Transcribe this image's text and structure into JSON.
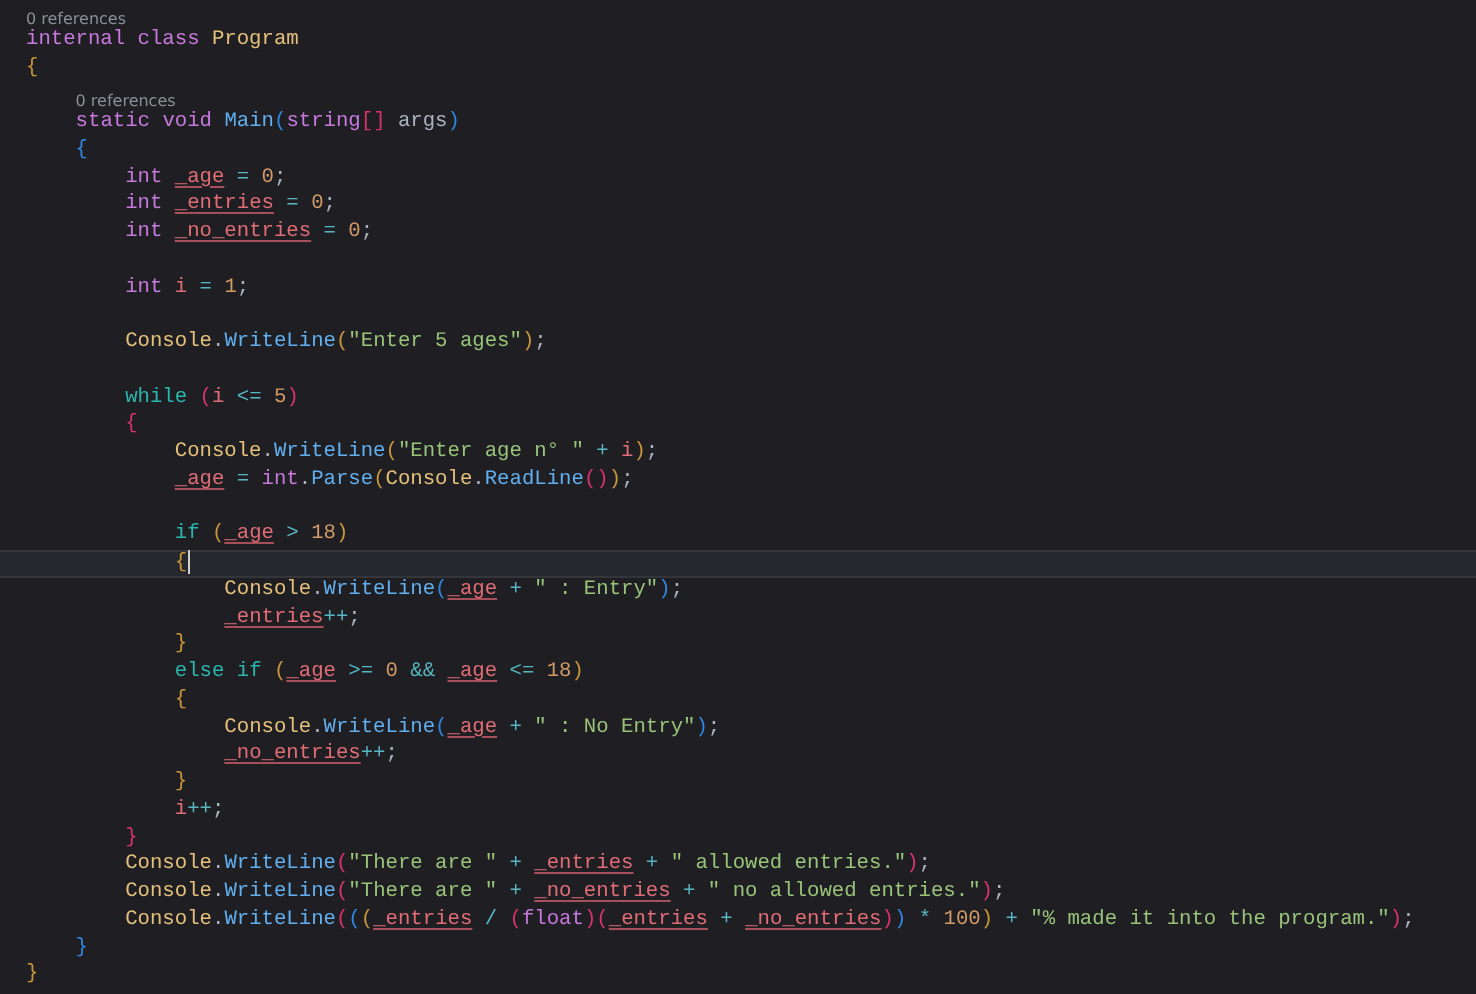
{
  "editor": {
    "lines": [
      {
        "codelens": "0 references",
        "current": false,
        "tokens": [
          {
            "kind": "keyword",
            "text": "internal "
          },
          {
            "kind": "keyword",
            "text": "class "
          },
          {
            "kind": "type",
            "text": "Program"
          }
        ]
      },
      {
        "current": false,
        "tokens": [
          {
            "kind": "bracket1",
            "text": "{"
          }
        ]
      },
      {
        "codelens": "0 references",
        "current": false,
        "tokens": [
          {
            "kind": "keyword",
            "text": "    static "
          },
          {
            "kind": "keyword",
            "text": "void "
          },
          {
            "kind": "method",
            "text": "Main"
          },
          {
            "kind": "bracket3",
            "text": "("
          },
          {
            "kind": "keyword",
            "text": "string"
          },
          {
            "kind": "bracket2",
            "text": "[] "
          },
          {
            "kind": "param",
            "text": "args"
          },
          {
            "kind": "bracket3",
            "text": ")"
          }
        ]
      },
      {
        "current": false,
        "tokens": [
          {
            "kind": "bracket3",
            "text": "    {"
          }
        ]
      },
      {
        "current": false,
        "tokens": [
          {
            "kind": "keyword",
            "text": "        int "
          },
          {
            "kind": "field",
            "text": "_age"
          },
          {
            "kind": "operator",
            "text": " = "
          },
          {
            "kind": "number",
            "text": "0"
          },
          {
            "kind": "plain",
            "text": ";"
          }
        ]
      },
      {
        "current": false,
        "tokens": [
          {
            "kind": "keyword",
            "text": "        int "
          },
          {
            "kind": "field",
            "text": "_entries"
          },
          {
            "kind": "operator",
            "text": " = "
          },
          {
            "kind": "number",
            "text": "0"
          },
          {
            "kind": "plain",
            "text": ";"
          }
        ]
      },
      {
        "current": false,
        "tokens": [
          {
            "kind": "keyword",
            "text": "        int "
          },
          {
            "kind": "field",
            "text": "_no_entries"
          },
          {
            "kind": "operator",
            "text": " = "
          },
          {
            "kind": "number",
            "text": "0"
          },
          {
            "kind": "plain",
            "text": ";"
          }
        ]
      },
      {
        "current": false
      },
      {
        "current": false,
        "tokens": [
          {
            "kind": "keyword",
            "text": "        int "
          },
          {
            "kind": "local",
            "text": "i"
          },
          {
            "kind": "operator",
            "text": " = "
          },
          {
            "kind": "number",
            "text": "1"
          },
          {
            "kind": "plain",
            "text": ";"
          }
        ]
      },
      {
        "current": false
      },
      {
        "current": false,
        "tokens": [
          {
            "kind": "type",
            "text": "        Console"
          },
          {
            "kind": "plain",
            "text": "."
          },
          {
            "kind": "method",
            "text": "WriteLine"
          },
          {
            "kind": "bracket1",
            "text": "("
          },
          {
            "kind": "string",
            "text": "\"Enter 5 ages\""
          },
          {
            "kind": "bracket1",
            "text": ")"
          },
          {
            "kind": "plain",
            "text": ";"
          }
        ]
      },
      {
        "current": false
      },
      {
        "current": false,
        "tokens": [
          {
            "kind": "control",
            "text": "        while "
          },
          {
            "kind": "bracket2",
            "text": "("
          },
          {
            "kind": "local",
            "text": "i"
          },
          {
            "kind": "operator",
            "text": " <= "
          },
          {
            "kind": "number",
            "text": "5"
          },
          {
            "kind": "bracket2",
            "text": ")"
          }
        ]
      },
      {
        "current": false,
        "tokens": [
          {
            "kind": "bracket2",
            "text": "        {"
          }
        ]
      },
      {
        "current": false,
        "tokens": [
          {
            "kind": "type",
            "text": "            Console"
          },
          {
            "kind": "plain",
            "text": "."
          },
          {
            "kind": "method",
            "text": "WriteLine"
          },
          {
            "kind": "bracket1",
            "text": "("
          },
          {
            "kind": "string",
            "text": "\"Enter age n° \""
          },
          {
            "kind": "operator",
            "text": " + "
          },
          {
            "kind": "local",
            "text": "i"
          },
          {
            "kind": "bracket1",
            "text": ")"
          },
          {
            "kind": "plain",
            "text": ";"
          }
        ]
      },
      {
        "current": false,
        "tokens": [
          {
            "kind": "field",
            "text": "            _age"
          },
          {
            "kind": "operator",
            "text": " = "
          },
          {
            "kind": "keyword",
            "text": "int"
          },
          {
            "kind": "plain",
            "text": "."
          },
          {
            "kind": "method",
            "text": "Parse"
          },
          {
            "kind": "bracket1",
            "text": "("
          },
          {
            "kind": "type",
            "text": "Console"
          },
          {
            "kind": "plain",
            "text": "."
          },
          {
            "kind": "method",
            "text": "ReadLine"
          },
          {
            "kind": "bracket2",
            "text": "()"
          },
          {
            "kind": "bracket1",
            "text": ")"
          },
          {
            "kind": "plain",
            "text": ";"
          }
        ]
      },
      {
        "current": false
      },
      {
        "current": false,
        "tokens": [
          {
            "kind": "control",
            "text": "            if "
          },
          {
            "kind": "bracket1",
            "text": "("
          },
          {
            "kind": "field",
            "text": "_age"
          },
          {
            "kind": "operator",
            "text": " > "
          },
          {
            "kind": "number",
            "text": "18"
          },
          {
            "kind": "bracket1",
            "text": ")"
          }
        ]
      },
      {
        "current": true,
        "tokens": [
          {
            "kind": "bracket1",
            "text": "            {"
          }
        ]
      },
      {
        "current": false,
        "tokens": [
          {
            "kind": "type",
            "text": "                Console"
          },
          {
            "kind": "plain",
            "text": "."
          },
          {
            "kind": "method",
            "text": "WriteLine"
          },
          {
            "kind": "bracket3",
            "text": "("
          },
          {
            "kind": "field",
            "text": "_age"
          },
          {
            "kind": "operator",
            "text": " + "
          },
          {
            "kind": "string",
            "text": "\" : Entry\""
          },
          {
            "kind": "bracket3",
            "text": ")"
          },
          {
            "kind": "plain",
            "text": ";"
          }
        ]
      },
      {
        "current": false,
        "tokens": [
          {
            "kind": "field",
            "text": "                _entries"
          },
          {
            "kind": "operator",
            "text": "++"
          },
          {
            "kind": "plain",
            "text": ";"
          }
        ]
      },
      {
        "current": false,
        "tokens": [
          {
            "kind": "bracket1",
            "text": "            }"
          }
        ]
      },
      {
        "current": false,
        "tokens": [
          {
            "kind": "control",
            "text": "            else "
          },
          {
            "kind": "control",
            "text": "if "
          },
          {
            "kind": "bracket1",
            "text": "("
          },
          {
            "kind": "field",
            "text": "_age"
          },
          {
            "kind": "operator",
            "text": " >= "
          },
          {
            "kind": "number",
            "text": "0"
          },
          {
            "kind": "operator",
            "text": " && "
          },
          {
            "kind": "field",
            "text": "_age"
          },
          {
            "kind": "operator",
            "text": " <= "
          },
          {
            "kind": "number",
            "text": "18"
          },
          {
            "kind": "bracket1",
            "text": ")"
          }
        ]
      },
      {
        "current": false,
        "tokens": [
          {
            "kind": "bracket1",
            "text": "            {"
          }
        ]
      },
      {
        "current": false,
        "tokens": [
          {
            "kind": "type",
            "text": "                Console"
          },
          {
            "kind": "plain",
            "text": "."
          },
          {
            "kind": "method",
            "text": "WriteLine"
          },
          {
            "kind": "bracket3",
            "text": "("
          },
          {
            "kind": "field",
            "text": "_age"
          },
          {
            "kind": "operator",
            "text": " + "
          },
          {
            "kind": "string",
            "text": "\" : No Entry\""
          },
          {
            "kind": "bracket3",
            "text": ")"
          },
          {
            "kind": "plain",
            "text": ";"
          }
        ]
      },
      {
        "current": false,
        "tokens": [
          {
            "kind": "field",
            "text": "                _no_entries"
          },
          {
            "kind": "operator",
            "text": "++"
          },
          {
            "kind": "plain",
            "text": ";"
          }
        ]
      },
      {
        "current": false,
        "tokens": [
          {
            "kind": "bracket1",
            "text": "            }"
          }
        ]
      },
      {
        "current": false,
        "tokens": [
          {
            "kind": "local",
            "text": "            i"
          },
          {
            "kind": "operator",
            "text": "++"
          },
          {
            "kind": "plain",
            "text": ";"
          }
        ]
      },
      {
        "current": false,
        "tokens": [
          {
            "kind": "bracket2",
            "text": "        }"
          }
        ]
      },
      {
        "current": false,
        "tokens": [
          {
            "kind": "type",
            "text": "        Console"
          },
          {
            "kind": "plain",
            "text": "."
          },
          {
            "kind": "method",
            "text": "WriteLine"
          },
          {
            "kind": "bracket2",
            "text": "("
          },
          {
            "kind": "string",
            "text": "\"There are \""
          },
          {
            "kind": "operator",
            "text": " + "
          },
          {
            "kind": "field",
            "text": "_entries"
          },
          {
            "kind": "operator",
            "text": " + "
          },
          {
            "kind": "string",
            "text": "\" allowed entries.\""
          },
          {
            "kind": "bracket2",
            "text": ")"
          },
          {
            "kind": "plain",
            "text": ";"
          }
        ]
      },
      {
        "current": false,
        "tokens": [
          {
            "kind": "type",
            "text": "        Console"
          },
          {
            "kind": "plain",
            "text": "."
          },
          {
            "kind": "method",
            "text": "WriteLine"
          },
          {
            "kind": "bracket2",
            "text": "("
          },
          {
            "kind": "string",
            "text": "\"There are \""
          },
          {
            "kind": "operator",
            "text": " + "
          },
          {
            "kind": "field",
            "text": "_no_entries"
          },
          {
            "kind": "operator",
            "text": " + "
          },
          {
            "kind": "string",
            "text": "\" no allowed entries.\""
          },
          {
            "kind": "bracket2",
            "text": ")"
          },
          {
            "kind": "plain",
            "text": ";"
          }
        ]
      },
      {
        "current": false,
        "tokens": [
          {
            "kind": "type",
            "text": "        Console"
          },
          {
            "kind": "plain",
            "text": "."
          },
          {
            "kind": "method",
            "text": "WriteLine"
          },
          {
            "kind": "bracket2",
            "text": "("
          },
          {
            "kind": "bracket3",
            "text": "("
          },
          {
            "kind": "bracket1",
            "text": "("
          },
          {
            "kind": "field",
            "text": "_entries"
          },
          {
            "kind": "operator",
            "text": " / "
          },
          {
            "kind": "bracket2",
            "text": "("
          },
          {
            "kind": "keyword",
            "text": "float"
          },
          {
            "kind": "bracket2",
            "text": ")("
          },
          {
            "kind": "field",
            "text": "_entries"
          },
          {
            "kind": "operator",
            "text": " + "
          },
          {
            "kind": "field",
            "text": "_no_entries"
          },
          {
            "kind": "bracket2",
            "text": ")"
          },
          {
            "kind": "bracket3",
            "text": ")"
          },
          {
            "kind": "operator",
            "text": " * "
          },
          {
            "kind": "number",
            "text": "100"
          },
          {
            "kind": "bracket1",
            "text": ")"
          },
          {
            "kind": "operator",
            "text": " + "
          },
          {
            "kind": "string",
            "text": "\"% made it into the program.\""
          },
          {
            "kind": "bracket2",
            "text": ")"
          },
          {
            "kind": "plain",
            "text": ";"
          }
        ]
      },
      {
        "current": false,
        "tokens": [
          {
            "kind": "bracket3",
            "text": "    }"
          }
        ]
      },
      {
        "current": false,
        "tokens": [
          {
            "kind": "bracket1",
            "text": "}"
          }
        ]
      }
    ]
  }
}
